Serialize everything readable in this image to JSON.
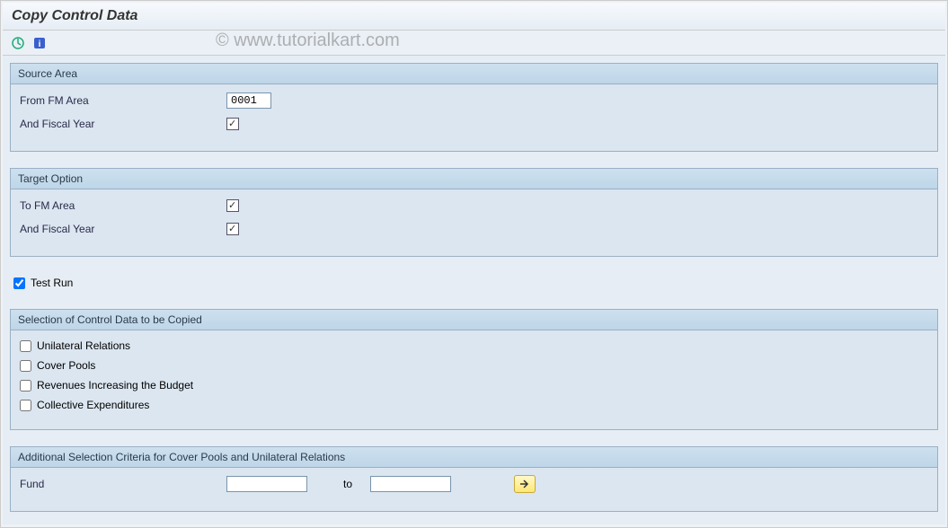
{
  "title": "Copy Control Data",
  "watermark": "© www.tutorialkart.com",
  "groups": {
    "source": {
      "title": "Source Area",
      "from_fm_label": "From FM Area",
      "from_fm_value": "0001",
      "fiscal_label": "And Fiscal Year"
    },
    "target": {
      "title": "Target Option",
      "to_fm_label": "To FM Area",
      "fiscal_label": "And Fiscal Year"
    },
    "testrun_label": "Test Run",
    "selection": {
      "title": "Selection of Control Data to be Copied",
      "opt1": "Unilateral Relations",
      "opt2": "Cover Pools",
      "opt3": "Revenues Increasing the Budget",
      "opt4": "Collective Expenditures"
    },
    "additional": {
      "title": "Additional Selection Criteria for Cover Pools and Unilateral Relations",
      "fund_label": "Fund",
      "to_label": "to"
    }
  }
}
